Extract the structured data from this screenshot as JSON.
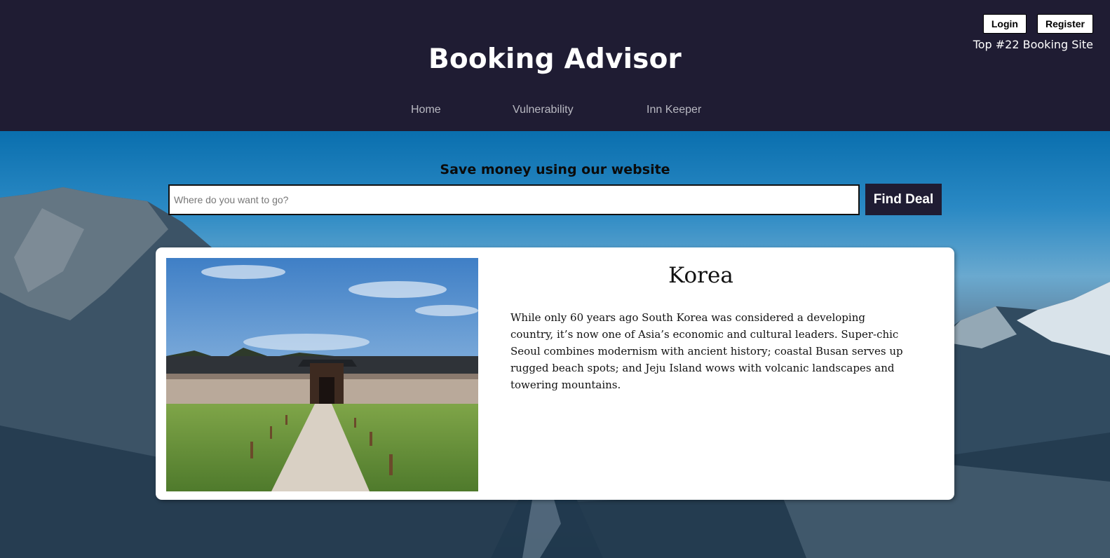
{
  "header": {
    "title": "Booking Advisor",
    "login_label": "Login",
    "register_label": "Register",
    "rank_text": "Top #22 Booking Site",
    "nav": [
      {
        "label": "Home"
      },
      {
        "label": "Vulnerability"
      },
      {
        "label": "Inn Keeper"
      }
    ]
  },
  "search": {
    "tagline": "Save money using our website",
    "placeholder": "Where do you want to go?",
    "value": "",
    "button_label": "Find Deal"
  },
  "card": {
    "title": "Korea",
    "description": "While only 60 years ago South Korea was considered a developing country, it’s now one of Asia’s economic and cultural leaders. Super-chic Seoul combines modernism with ancient history; coastal Busan serves up rugged beach spots; and Jeju Island wows with volcanic landscapes and towering mountains."
  },
  "colors": {
    "header_bg": "#1f1c33",
    "button_dark": "#1f1c33",
    "nav_text": "#b9b9c2"
  }
}
